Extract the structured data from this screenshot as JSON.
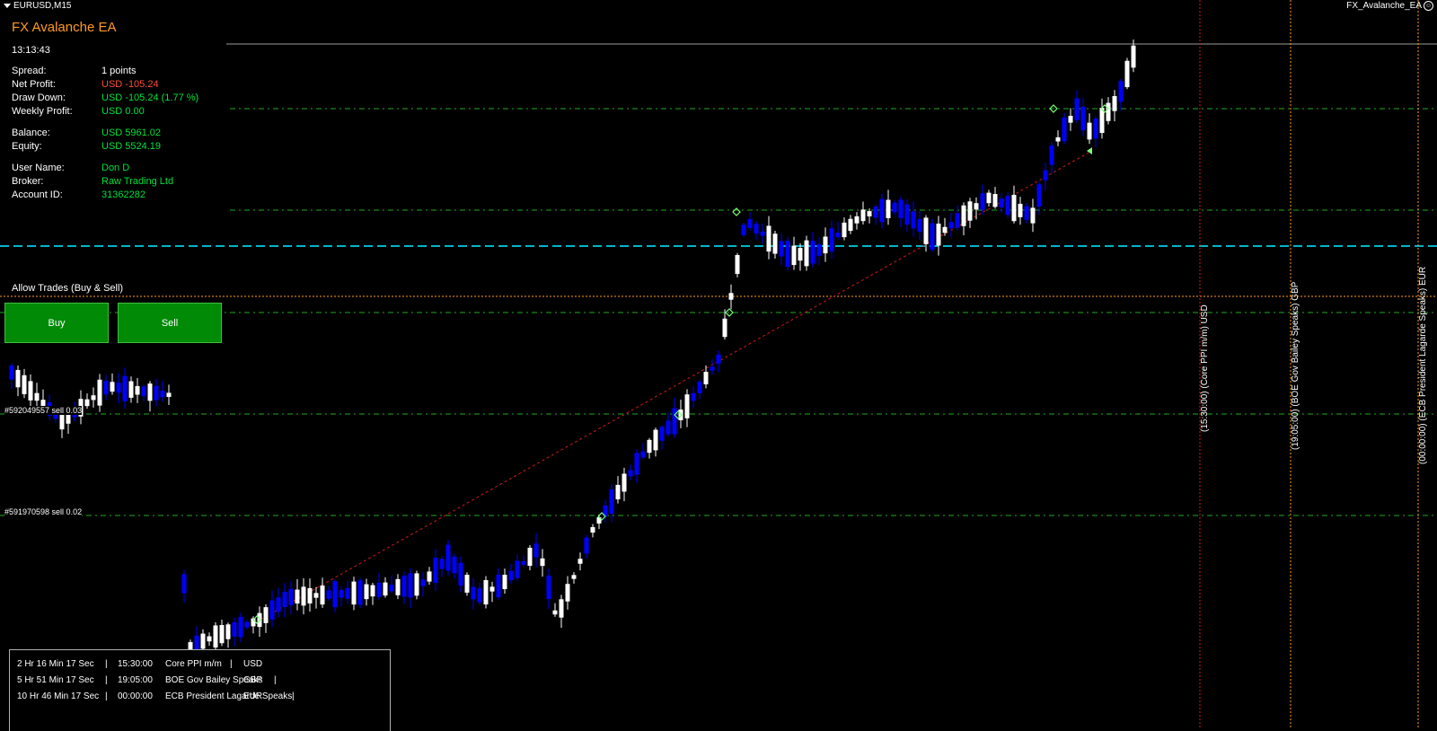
{
  "chart": {
    "symbol": "EURUSD,M15",
    "indicator_name": "FX_Avalanche_EA",
    "colors": {
      "bull": "#0000ff",
      "bear": "#ffffff",
      "grid_green": "#1faa1f",
      "cyan": "#00b5c8",
      "orange": "#ff9a1f",
      "red": "#d11a1a"
    },
    "order_labels": [
      "#592049557 sell 0.03",
      "#591970598 sell 0.02"
    ],
    "event_labels": [
      "(15:30:00) (Core PPI m/m) USD",
      "(19:05:00) (BOE Gov Bailey Speaks) GBP",
      "(00:00:00) (ECB President Lagarde Speaks) EUR"
    ]
  },
  "panel": {
    "title": "FX Avalanche EA",
    "time": "13:13:43",
    "rows": [
      {
        "label": "Spread:",
        "value": "1 points",
        "color": "white"
      },
      {
        "label": "Net Profit:",
        "value": "USD -105.24",
        "color": "red"
      },
      {
        "label": "Draw Down:",
        "value": "USD -105.24 (1.77 %)",
        "color": "green"
      },
      {
        "label": "Weekly Profit:",
        "value": "USD 0.00",
        "color": "green"
      },
      {
        "label": "Balance:",
        "value": "USD 5961.02",
        "color": "green"
      },
      {
        "label": "Equity:",
        "value": "USD 5524.19",
        "color": "green"
      },
      {
        "label": "User Name:",
        "value": "Don D",
        "color": "green"
      },
      {
        "label": "Broker:",
        "value": "Raw Trading Ltd",
        "color": "green"
      },
      {
        "label": "Account ID:",
        "value": "31362282",
        "color": "green"
      }
    ],
    "allow_trades": "Allow Trades (Buy & Sell)",
    "buy_label": "Buy",
    "sell_label": "Sell"
  },
  "news": [
    {
      "countdown": "2 Hr 16 Min 17 Sec",
      "sep1": "|",
      "time": "15:30:00",
      "event": "Core PPI m/m",
      "sep2": "|",
      "currency": "USD"
    },
    {
      "countdown": "5 Hr 51 Min 17 Sec",
      "sep1": "|",
      "time": "19:05:00",
      "event": "BOE Gov Bailey Speaks",
      "sep2": "|",
      "currency": "GBP"
    },
    {
      "countdown": "10 Hr 46 Min 17 Sec",
      "sep1": "|",
      "time": "00:00:00",
      "event": "ECB President Lagarde Speaks",
      "sep2": "|",
      "currency": "EUR"
    }
  ]
}
